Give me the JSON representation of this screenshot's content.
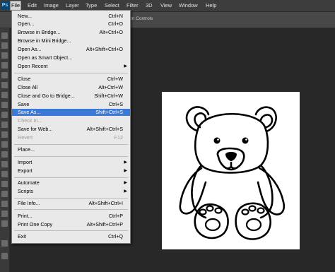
{
  "menubar": {
    "logo": "Ps",
    "items": [
      "File",
      "Edit",
      "Image",
      "Layer",
      "Type",
      "Select",
      "Filter",
      "3D",
      "View",
      "Window",
      "Help"
    ]
  },
  "options": {
    "label": "m Controls"
  },
  "file_menu": {
    "items": [
      {
        "label": "New...",
        "shortcut": "Ctrl+N"
      },
      {
        "label": "Open...",
        "shortcut": "Ctrl+O"
      },
      {
        "label": "Browse in Bridge...",
        "shortcut": "Alt+Ctrl+O"
      },
      {
        "label": "Browse in Mini Bridge...",
        "shortcut": ""
      },
      {
        "label": "Open As...",
        "shortcut": "Alt+Shift+Ctrl+O"
      },
      {
        "label": "Open as Smart Object...",
        "shortcut": ""
      },
      {
        "label": "Open Recent",
        "shortcut": "",
        "submenu": true
      },
      {
        "label": "Close",
        "shortcut": "Ctrl+W"
      },
      {
        "label": "Close All",
        "shortcut": "Alt+Ctrl+W"
      },
      {
        "label": "Close and Go to Bridge...",
        "shortcut": "Shift+Ctrl+W"
      },
      {
        "label": "Save",
        "shortcut": "Ctrl+S"
      },
      {
        "label": "Save As...",
        "shortcut": "Shift+Ctrl+S",
        "highlighted": true
      },
      {
        "label": "Check In...",
        "shortcut": "",
        "disabled": true
      },
      {
        "label": "Save for Web...",
        "shortcut": "Alt+Shift+Ctrl+S"
      },
      {
        "label": "Revert",
        "shortcut": "F12",
        "disabled": true
      },
      {
        "label": "Place...",
        "shortcut": ""
      },
      {
        "label": "Import",
        "shortcut": "",
        "submenu": true
      },
      {
        "label": "Export",
        "shortcut": "",
        "submenu": true
      },
      {
        "label": "Automate",
        "shortcut": "",
        "submenu": true
      },
      {
        "label": "Scripts",
        "shortcut": "",
        "submenu": true
      },
      {
        "label": "File Info...",
        "shortcut": "Alt+Shift+Ctrl+I"
      },
      {
        "label": "Print...",
        "shortcut": "Ctrl+P"
      },
      {
        "label": "Print One Copy",
        "shortcut": "Alt+Shift+Ctrl+P"
      },
      {
        "label": "Exit",
        "shortcut": "Ctrl+Q"
      }
    ]
  },
  "colors": {
    "highlight": "#3a79d8",
    "menu_bg": "#e9e9e9",
    "canvas_bg": "#282828"
  }
}
